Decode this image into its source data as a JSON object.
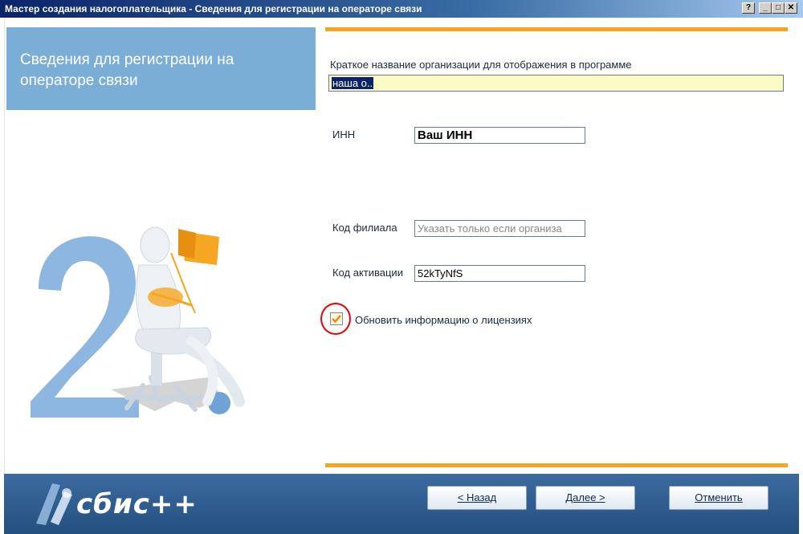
{
  "window": {
    "title": "Мастер создания налогоплательщика - Сведения для регистрации на операторе связи",
    "help_label": "?",
    "minimize_label": "_",
    "maximize_label": "□",
    "close_label": "✕"
  },
  "header": {
    "title": "Сведения для регистрации на операторе связи"
  },
  "form": {
    "short_name_label": "Краткое название организации для отображения в программе",
    "short_name_value": "наша о..",
    "inn_label": "ИНН",
    "inn_value": "Ваш ИНН",
    "branch_label": "Код филиала",
    "branch_placeholder": "Указать только если организа",
    "activation_label": "Код активации",
    "activation_value": "52kTyNfS",
    "update_license_label": "Обновить информацию о лицензиях",
    "update_license_checked": true
  },
  "footer": {
    "logo_text": "сбис++",
    "back_label": "< Назад",
    "next_label": "Далее >",
    "cancel_label": "Отменить"
  },
  "colors": {
    "accent_orange": "#f5a623",
    "header_blue": "#7aaed6",
    "footer_blue": "#2d5c8f",
    "highlight_field": "#fdfbc4"
  }
}
